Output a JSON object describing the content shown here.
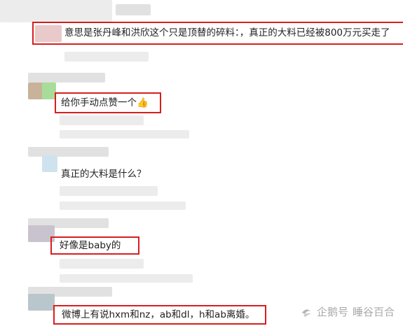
{
  "comments": [
    {
      "text": "意思是张丹峰和洪欣这个只是顶替的碎料：，真正的大料已经被800万元买走了"
    },
    {
      "text": "给你手动点赞一个",
      "emoji": "👍"
    },
    {
      "text": "真正的大料是什么？"
    },
    {
      "text": "好像是baby的"
    },
    {
      "text": "微博上有说hxm和nz，ab和dl，h和ab离婚。"
    }
  ],
  "watermark": {
    "brand": "企鹅号",
    "name": "睡谷百合"
  },
  "colors": {
    "highlight_box": "#d81e1e",
    "watermark": "#a9a9a9"
  }
}
